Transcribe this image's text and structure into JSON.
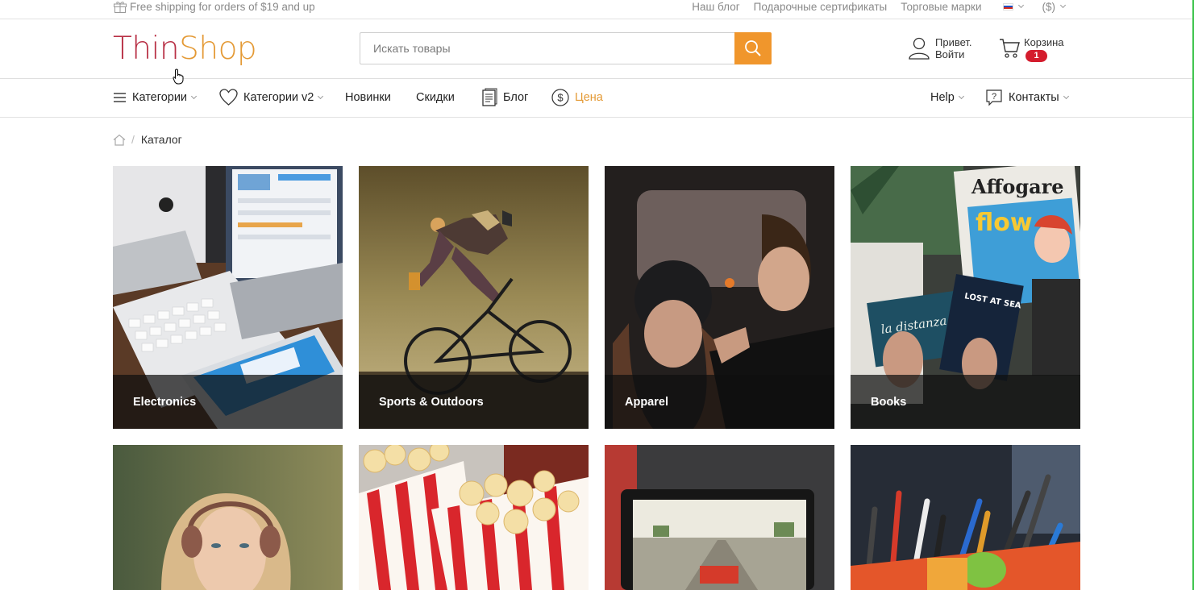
{
  "topbar": {
    "shipping_text": "Free shipping for orders of $19 and up",
    "links": [
      "Наш блог",
      "Подарочные сертификаты",
      "Торговые марки"
    ],
    "currency": "($)"
  },
  "header": {
    "logo_part1": "Thin",
    "logo_part2": "Shop",
    "search_placeholder": "Искать товары",
    "account_greeting": "Привет.",
    "account_login": "Войти",
    "cart_label": "Корзина",
    "cart_count": "1"
  },
  "nav": {
    "categories": "Категории",
    "categories_v2": "Категории v2",
    "new": "Новинки",
    "discounts": "Скидки",
    "blog": "Блог",
    "price": "Цена",
    "help": "Help",
    "contacts": "Контакты"
  },
  "breadcrumb": {
    "current": "Каталог"
  },
  "catalog": {
    "tiles": [
      "Electronics",
      "Sports & Outdoors",
      "Apparel",
      "Books"
    ]
  },
  "colors": {
    "accent": "#f0962c",
    "logo_red": "#b83045",
    "logo_orange": "#e49a36",
    "badge": "#d41c2d"
  }
}
